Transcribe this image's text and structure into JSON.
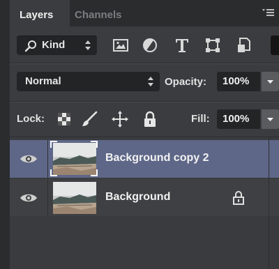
{
  "tabs": [
    {
      "label": "Layers",
      "active": true
    },
    {
      "label": "Channels",
      "active": false
    }
  ],
  "filter": {
    "kind_label": "Kind",
    "icons": [
      "image-filter-icon",
      "adjustment-filter-icon",
      "type-filter-icon",
      "shape-filter-icon",
      "smart-object-filter-icon"
    ]
  },
  "blend": {
    "mode": "Normal",
    "opacity_label": "Opacity:",
    "opacity_value": "100%"
  },
  "lock": {
    "label": "Lock:",
    "icons": [
      "lock-transparent-pixels-icon",
      "lock-image-pixels-icon",
      "lock-position-icon",
      "lock-all-icon"
    ],
    "fill_label": "Fill:",
    "fill_value": "100%"
  },
  "layers": [
    {
      "name": "Background copy 2",
      "selected": true,
      "visible": true,
      "locked": false
    },
    {
      "name": "Background",
      "selected": false,
      "visible": true,
      "locked": true
    }
  ],
  "colors": {
    "panel": "#3b3c3f",
    "selected_row": "#5e6788",
    "field": "#232426"
  }
}
